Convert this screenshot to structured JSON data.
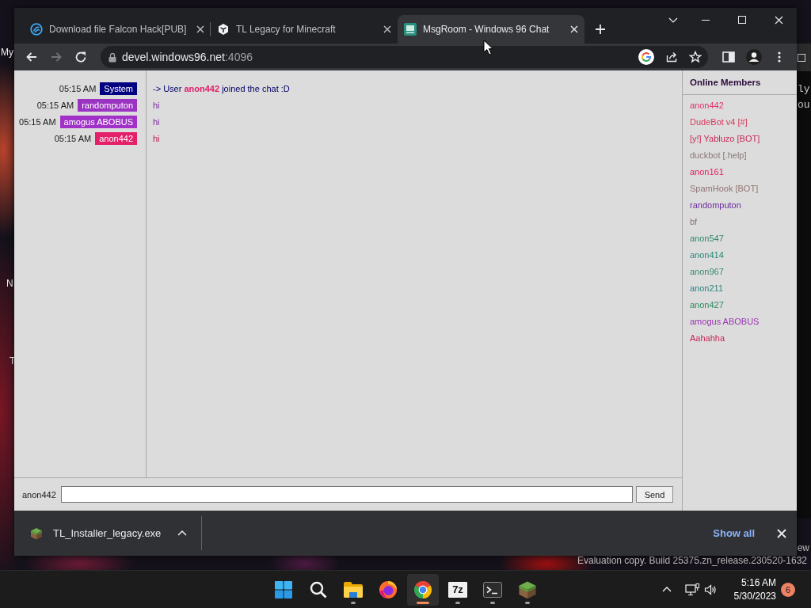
{
  "desktop": {
    "icon_labels": [
      "My",
      "N",
      "T"
    ],
    "terminal_lines": [
      "ly",
      "ou"
    ],
    "edition_fragment": "ew",
    "build_info": "Evaluation copy. Build 25375.zn_release.230520-1632"
  },
  "browser": {
    "tabs": [
      {
        "kind": "swirl",
        "title": "Download file Falcon Hack[PUB]",
        "selected": false
      },
      {
        "kind": "cube",
        "title": "TL Legacy for Minecraft",
        "selected": false
      },
      {
        "kind": "chat",
        "title": "MsgRoom - Windows 96 Chat",
        "selected": true
      }
    ],
    "nav": [
      {
        "kind": "back",
        "disabled": false
      },
      {
        "kind": "forward",
        "disabled": true
      },
      {
        "kind": "reload",
        "disabled": false
      }
    ],
    "address": {
      "host": "devel.windows96.net",
      "port": ":4096"
    },
    "download": {
      "file": "TL_Installer_legacy.exe",
      "show_all": "Show all"
    }
  },
  "chat": {
    "messages": [
      {
        "time": "05:15 AM",
        "user": "System",
        "color": "#000080",
        "text": "-> User **anon442** joined the chat :D"
      },
      {
        "time": "05:15 AM",
        "user": "randomputon",
        "color": "#9a32c2",
        "text": "hi"
      },
      {
        "time": "05:15 AM",
        "user": "amogus ABOBUS",
        "color": "#a132c8",
        "text": "hi"
      },
      {
        "time": "05:15 AM",
        "user": "anon442",
        "color": "#e4206a",
        "text": "hi"
      }
    ],
    "members_title": "Online Members",
    "members": [
      {
        "name": "anon442",
        "color": "#e0306a"
      },
      {
        "name": "DudeBot v4 [#]",
        "color": "#d63a5a"
      },
      {
        "name": "[y!] Yabluzo [BOT]",
        "color": "#c82a5a"
      },
      {
        "name": "duckbot [.help]",
        "color": "#8c7878"
      },
      {
        "name": "anon161",
        "color": "#e0205e"
      },
      {
        "name": "SpamHook [BOT]",
        "color": "#927474"
      },
      {
        "name": "randomputon",
        "color": "#6a2c9e"
      },
      {
        "name": "bf",
        "color": "#8c7474"
      },
      {
        "name": "anon547",
        "color": "#2e8a6e"
      },
      {
        "name": "anon414",
        "color": "#2a8878"
      },
      {
        "name": "anon967",
        "color": "#3a8a6c"
      },
      {
        "name": "anon211",
        "color": "#2a8684"
      },
      {
        "name": "anon427",
        "color": "#2a8a60"
      },
      {
        "name": "amogus ABOBUS",
        "color": "#9a34b4"
      },
      {
        "name": "Aahahha",
        "color": "#c42858"
      }
    ],
    "composer": {
      "nickname": "anon442",
      "button": "Send"
    }
  },
  "taskbar": {
    "apps": [
      {
        "kind": "start",
        "running": false,
        "selected": false
      },
      {
        "kind": "search",
        "running": false,
        "selected": false
      },
      {
        "kind": "files",
        "running": true,
        "selected": false
      },
      {
        "kind": "firefox",
        "running": false,
        "selected": false
      },
      {
        "kind": "chrome",
        "running": true,
        "selected": true
      },
      {
        "kind": "archive",
        "text": "7z",
        "running": true,
        "selected": false
      },
      {
        "kind": "terminal",
        "running": true,
        "selected": false
      },
      {
        "kind": "grass",
        "running": true,
        "selected": false
      }
    ],
    "time": "5:16 AM",
    "date": "5/30/2023",
    "notifications": "6"
  }
}
